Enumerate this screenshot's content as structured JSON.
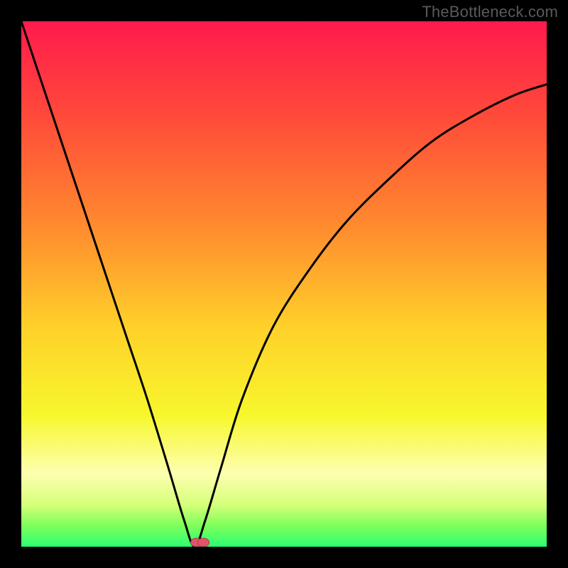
{
  "watermark": "TheBottleneck.com",
  "colors": {
    "frame_background": "#000000",
    "curve_stroke": "#000000",
    "marker_fill": "#e2536a",
    "marker_stroke": "#a63b4c",
    "gradient_stops": [
      {
        "offset": 0.0,
        "color": "#ff1a4d"
      },
      {
        "offset": 0.18,
        "color": "#ff4a3a"
      },
      {
        "offset": 0.4,
        "color": "#ff8e2e"
      },
      {
        "offset": 0.58,
        "color": "#ffd02a"
      },
      {
        "offset": 0.75,
        "color": "#f7f72c"
      },
      {
        "offset": 0.86,
        "color": "#fdffb0"
      },
      {
        "offset": 0.92,
        "color": "#d6ff7a"
      },
      {
        "offset": 0.96,
        "color": "#7dff5a"
      },
      {
        "offset": 1.0,
        "color": "#2cff74"
      }
    ]
  },
  "chart_data": {
    "type": "line",
    "title": "",
    "xlabel": "",
    "ylabel": "",
    "xlim": [
      0,
      100
    ],
    "ylim": [
      0,
      100
    ],
    "grid": false,
    "legend": false,
    "optimal_x": 33,
    "marker": {
      "x": 34,
      "y": 0
    },
    "series": [
      {
        "name": "bottleneck-curve",
        "x": [
          0,
          4,
          8,
          12,
          16,
          20,
          24,
          28,
          31,
          33,
          35,
          38,
          42,
          48,
          55,
          62,
          70,
          78,
          86,
          94,
          100
        ],
        "values": [
          100,
          88,
          76,
          64,
          52,
          40,
          28,
          15,
          5,
          0,
          5,
          15,
          28,
          42,
          53,
          62,
          70,
          77,
          82,
          86,
          88
        ]
      }
    ]
  }
}
